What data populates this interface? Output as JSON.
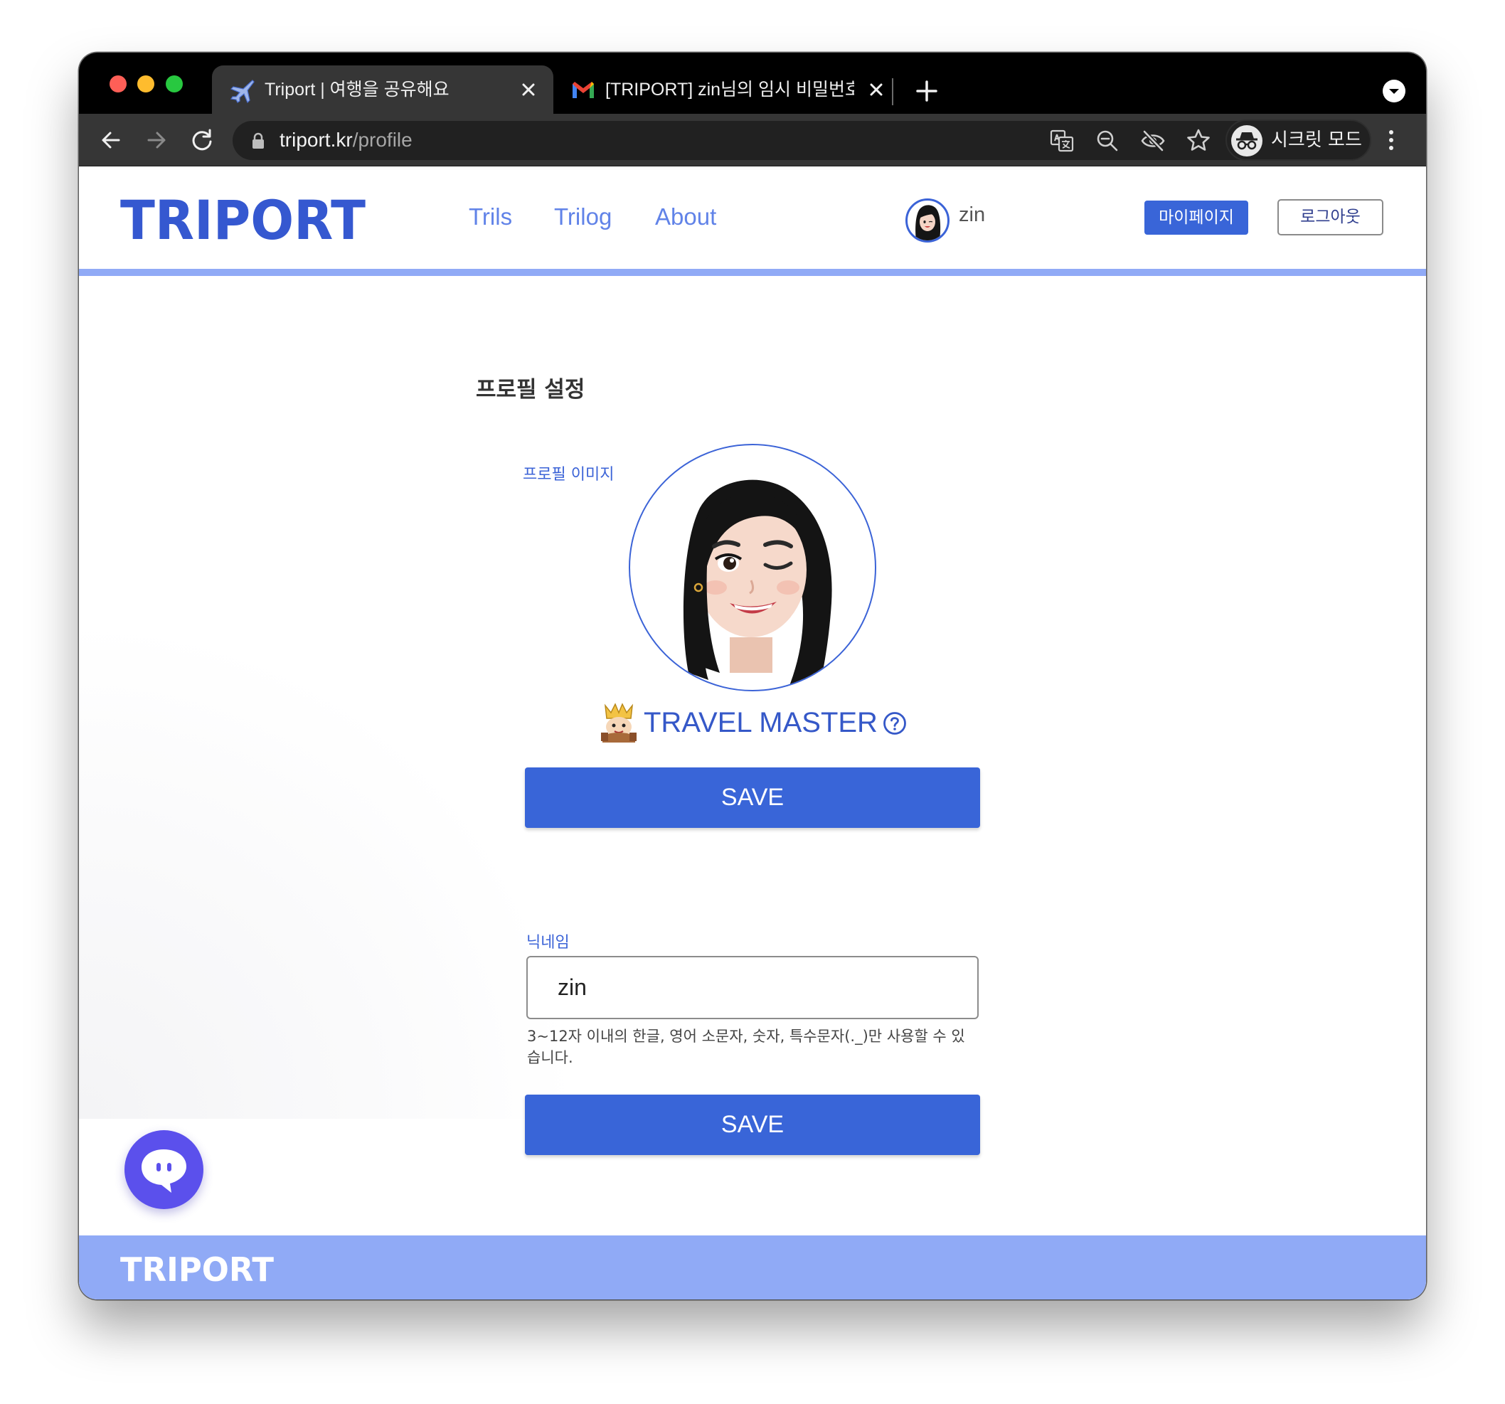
{
  "browser": {
    "tabs": [
      {
        "title": "Triport | 여행을 공유해요",
        "active": true
      },
      {
        "title": "[TRIPORT] zin님의 임시 비밀번호를",
        "active": false
      }
    ],
    "url_host": "triport.kr",
    "url_path": "/profile",
    "incognito_label": "시크릿 모드"
  },
  "header": {
    "logo": "TRIPORT",
    "nav": [
      "Trils",
      "Trilog",
      "About"
    ],
    "user_name": "zin",
    "mypage_label": "마이페이지",
    "logout_label": "로그아웃"
  },
  "profile": {
    "section_title": "프로필 설정",
    "image_label": "프로필 이미지",
    "rank_title": "TRAVEL MASTER",
    "save_image_label": "SAVE",
    "nickname_label": "닉네임",
    "nickname_value": "zin",
    "nickname_helper": "3~12자 이내의 한글, 영어 소문자, 숫자, 특수문자(._)만 사용할 수 있습니다.",
    "save_nickname_label": "SAVE"
  },
  "footer": {
    "logo": "TRIPORT"
  },
  "colors": {
    "brand_blue": "#3965d8",
    "header_bar": "#90aaf6",
    "chat_button": "#5b50ec"
  }
}
